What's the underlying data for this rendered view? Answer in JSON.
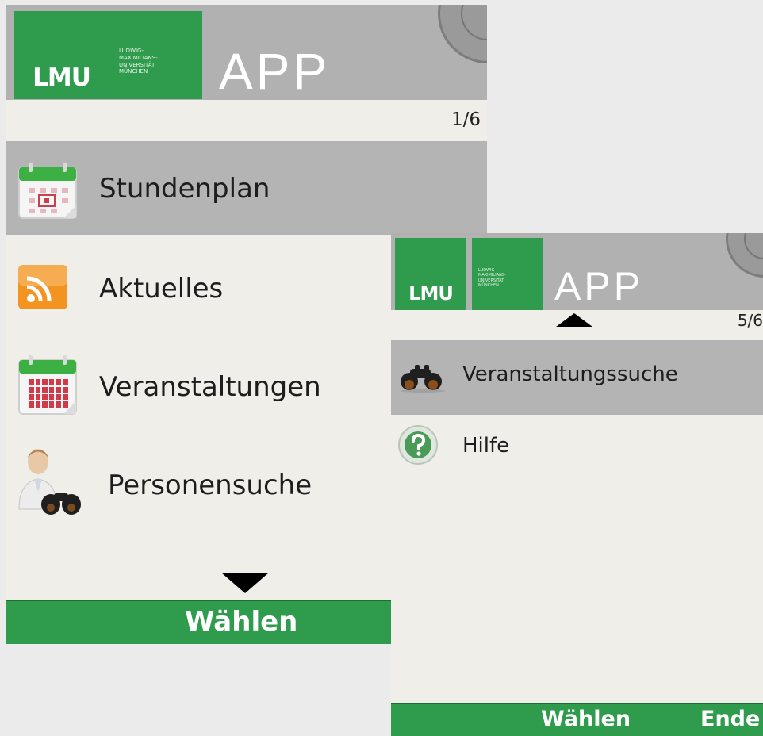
{
  "colors": {
    "brand_green": "#2f9b4c",
    "header_gray": "#b1b1b1",
    "selection_gray": "#b4b4b4",
    "background": "#efeee9"
  },
  "screen1": {
    "logo": {
      "short": "LMU",
      "university": "Ludwig-\nMaximilians-\nUniversität\nMünchen",
      "app": "APP"
    },
    "page_indicator": "1/6",
    "menu": [
      {
        "label": "Stundenplan",
        "icon": "calendar-icon",
        "selected": true
      },
      {
        "label": "Aktuelles",
        "icon": "rss-feed-icon",
        "selected": false
      },
      {
        "label": "Veranstaltungen",
        "icon": "events-calendar-icon",
        "selected": false
      },
      {
        "label": "Personensuche",
        "icon": "person-search-icon",
        "selected": false
      }
    ],
    "scroll_indicator": "down-arrow-icon",
    "softkeys": {
      "center": "Wählen"
    }
  },
  "screen2": {
    "logo": {
      "short": "LMU",
      "university": "Ludwig-\nMaximilians-\nUniversität\nMünchen",
      "app": "APP"
    },
    "page_indicator": "5/6",
    "scroll_indicator": "up-arrow-icon",
    "menu": [
      {
        "label": "Veranstaltungssuche",
        "icon": "binoculars-icon",
        "selected": true
      },
      {
        "label": "Hilfe",
        "icon": "help-icon",
        "selected": false
      }
    ],
    "softkeys": {
      "center": "Wählen",
      "right": "Ende"
    }
  }
}
